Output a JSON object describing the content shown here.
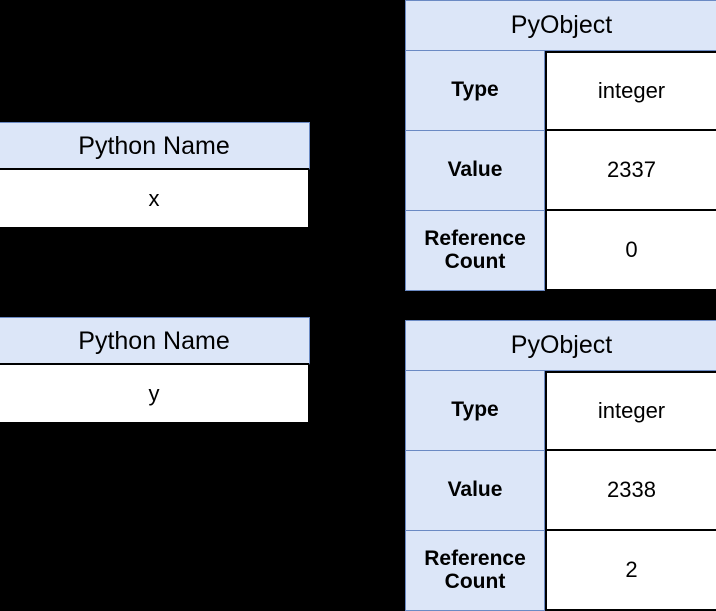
{
  "colors": {
    "background": "#000000",
    "header_fill": "#dce6f8",
    "header_border": "#6b8ac4",
    "cell_fill": "#ffffff",
    "cell_border": "#000000",
    "text": "#000000"
  },
  "name_boxes": [
    {
      "header": "Python Name",
      "value": "x"
    },
    {
      "header": "Python Name",
      "value": "y"
    }
  ],
  "pyobjects": [
    {
      "title": "PyObject",
      "rows": [
        {
          "key": "Type",
          "value": "integer"
        },
        {
          "key": "Value",
          "value": "2337"
        },
        {
          "key": "Reference Count",
          "value": "0"
        }
      ]
    },
    {
      "title": "PyObject",
      "rows": [
        {
          "key": "Type",
          "value": "integer"
        },
        {
          "key": "Value",
          "value": "2338"
        },
        {
          "key": "Reference Count",
          "value": "2"
        }
      ]
    }
  ]
}
